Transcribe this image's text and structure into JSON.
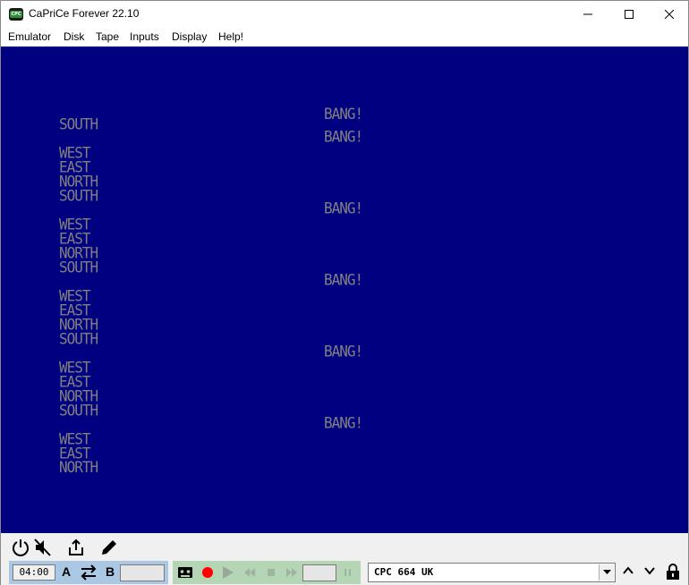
{
  "window": {
    "title": "CaPriCe Forever 22.10",
    "icon_label": "CPC"
  },
  "menu": {
    "items": [
      "Emulator",
      "Disk",
      "Tape",
      "Inputs",
      "Display",
      "Help!"
    ]
  },
  "screen": {
    "background": "#000080",
    "text_color": "#808080",
    "left_column": [
      {
        "row": 0,
        "text": "SOUTH"
      },
      {
        "row": 2,
        "text": "WEST"
      },
      {
        "row": 3,
        "text": "EAST"
      },
      {
        "row": 4,
        "text": "NORTH"
      },
      {
        "row": 5,
        "text": "SOUTH"
      },
      {
        "row": 7,
        "text": "WEST"
      },
      {
        "row": 8,
        "text": "EAST"
      },
      {
        "row": 9,
        "text": "NORTH"
      },
      {
        "row": 10,
        "text": "SOUTH"
      },
      {
        "row": 12,
        "text": "WEST"
      },
      {
        "row": 13,
        "text": "EAST"
      },
      {
        "row": 14,
        "text": "NORTH"
      },
      {
        "row": 15,
        "text": "SOUTH"
      },
      {
        "row": 17,
        "text": "WEST"
      },
      {
        "row": 18,
        "text": "EAST"
      },
      {
        "row": 19,
        "text": "NORTH"
      },
      {
        "row": 20,
        "text": "SOUTH"
      },
      {
        "row": 22,
        "text": "WEST"
      },
      {
        "row": 23,
        "text": "EAST"
      },
      {
        "row": 24,
        "text": "NORTH"
      }
    ],
    "right_column": [
      {
        "row": 0,
        "text": "BANG!"
      },
      {
        "row": 1,
        "text": "BANG!"
      },
      {
        "row": 6,
        "text": "BANG!"
      },
      {
        "row": 11,
        "text": "BANG!"
      },
      {
        "row": 16,
        "text": "BANG!"
      },
      {
        "row": 21,
        "text": "BANG!"
      }
    ]
  },
  "controls": {
    "top_icons": [
      "power-icon",
      "mute-icon",
      "share-icon",
      "pen-icon"
    ],
    "disk": {
      "time": "04:00",
      "drive_a": "A",
      "drive_b": "B",
      "accent": "#aac8e4"
    },
    "tape": {
      "accent": "#b4d6b4",
      "record_color": "#ff0000"
    },
    "model": {
      "selected": "CPC 664 UK"
    }
  }
}
